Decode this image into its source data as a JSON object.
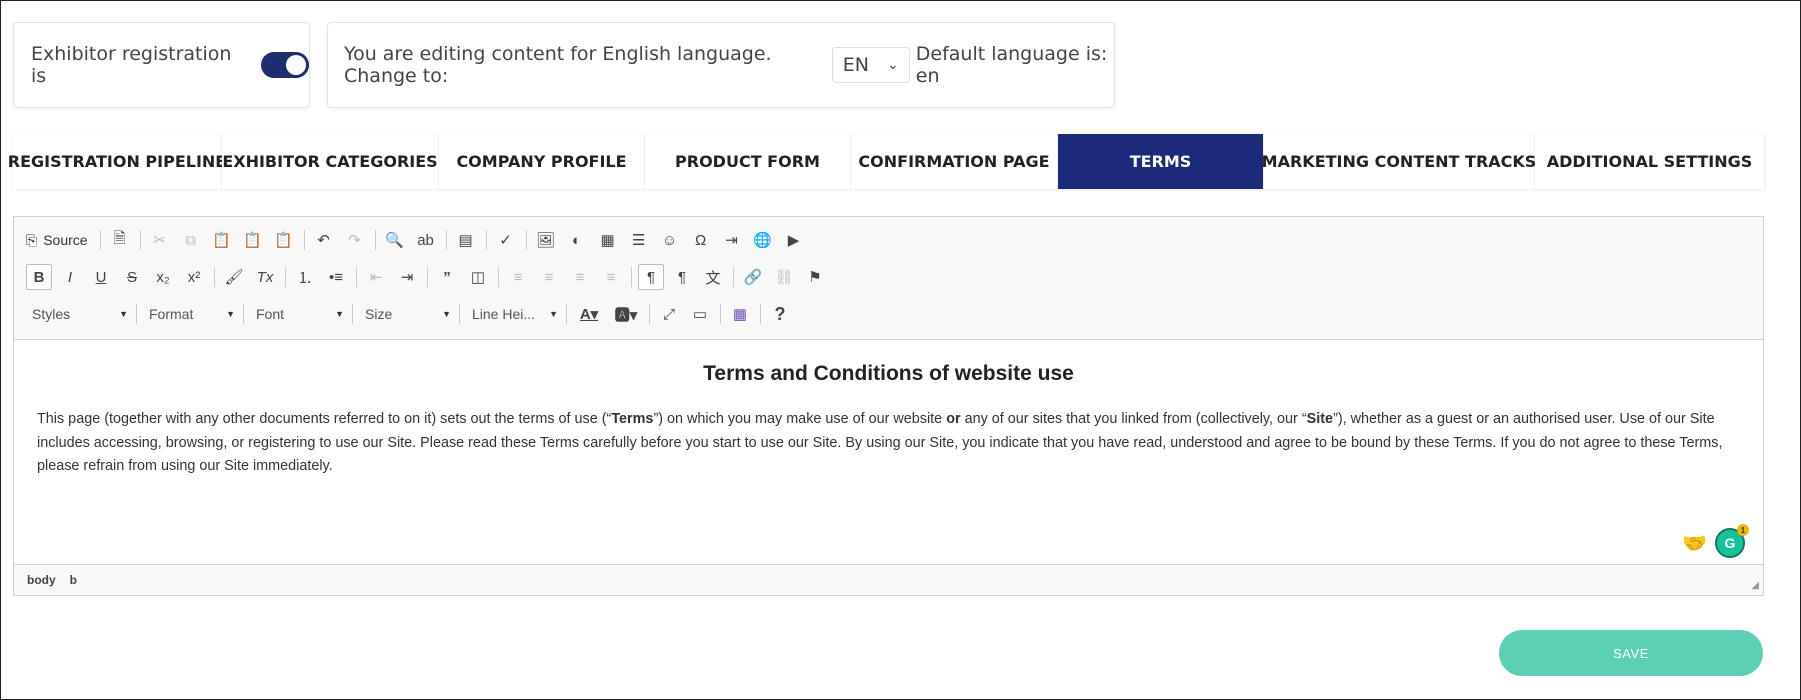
{
  "registration": {
    "label": "Exhibitor registration is",
    "enabled": true
  },
  "language": {
    "prefix": "You are editing content for English language. Change to:",
    "selected": "EN",
    "default_text": "Default language is: en"
  },
  "tabs": [
    {
      "label": "REGISTRATION PIPELINE",
      "active": false
    },
    {
      "label": "EXHIBITOR CATEGORIES",
      "active": false
    },
    {
      "label": "COMPANY PROFILE",
      "active": false
    },
    {
      "label": "PRODUCT FORM",
      "active": false
    },
    {
      "label": "CONFIRMATION PAGE",
      "active": false
    },
    {
      "label": "TERMS",
      "active": true
    },
    {
      "label": "MARKETING CONTENT TRACKS",
      "active": false
    },
    {
      "label": "ADDITIONAL SETTINGS",
      "active": false
    }
  ],
  "toolbar": {
    "source_label": "Source",
    "combos": {
      "styles": "Styles",
      "format": "Format",
      "font": "Font",
      "size": "Size",
      "line_height": "Line Hei..."
    }
  },
  "document": {
    "title": "Terms and Conditions of website use",
    "p1": "This page (together with any other documents referred to on it) sets out the terms of use (“",
    "p_terms": "Terms",
    "p2": "”) on which you may make use of our website ",
    "p_or": "or",
    "p3": " any of our sites that you linked from (collectively, our “",
    "p_site": "Site",
    "p4": "”), whether as a guest or an authorised user. Use of our Site includes accessing, browsing, or registering to use our Site. Please read these Terms carefully before you start to use our Site. By using our Site, you indicate that you have read, understood and agree to be bound by these Terms. If you do not agree to these Terms, please refrain from using our Site immediately."
  },
  "statusbar": {
    "path": [
      "body",
      "b"
    ]
  },
  "grammarly": {
    "letter": "G",
    "count": "1"
  },
  "save_label": "SAVE",
  "colors": {
    "primary": "#1c2a7a",
    "save": "#5ccfb4"
  }
}
